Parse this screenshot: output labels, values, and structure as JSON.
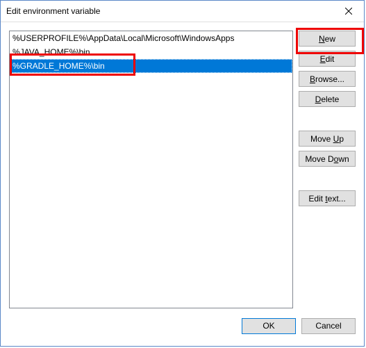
{
  "window": {
    "title": "Edit environment variable"
  },
  "list": {
    "items": [
      "%USERPROFILE%\\AppData\\Local\\Microsoft\\WindowsApps",
      "%JAVA_HOME%\\bin",
      "%GRADLE_HOME%\\bin"
    ],
    "selected_index": 2
  },
  "buttons": {
    "new": "New",
    "edit": "Edit",
    "browse": "Browse...",
    "delete": "Delete",
    "move_up": "Move Up",
    "move_down": "Move Down",
    "edit_text": "Edit text...",
    "ok": "OK",
    "cancel": "Cancel"
  }
}
